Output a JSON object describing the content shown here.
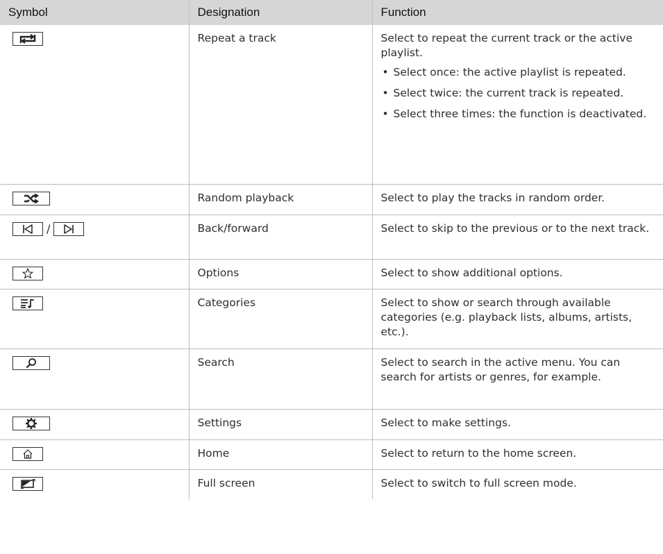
{
  "header": {
    "symbol": "Symbol",
    "designation": "Designation",
    "function": "Function"
  },
  "rows": [
    {
      "icon": "repeat-icon",
      "designation": "Repeat a track",
      "function": "Select to repeat the current track or the active playlist.",
      "bullets": [
        "Select once: the active playlist is repea­ted.",
        "Select twice: the current track is repea­ted.",
        "Select three times: the function is deactivated."
      ]
    },
    {
      "icon": "shuffle-icon",
      "designation": "Random playback",
      "function": "Select to play the tracks in random order."
    },
    {
      "icon": "skip-back-icon / skip-forward-icon",
      "separator": "/",
      "designation": "Back/forward",
      "function": "Select to skip to the previous or to the next track."
    },
    {
      "icon": "star-outline-icon",
      "designation": "Options",
      "function": "Select to show additional options."
    },
    {
      "icon": "playlist-music-icon",
      "designation": "Categories",
      "function": "Select to show or search through available categories (e.g. playback lists, albums, artists, etc.)."
    },
    {
      "icon": "search-icon",
      "designation": "Search",
      "function": "Select to search in the active menu. You can search for artists or genres, for exam­ple."
    },
    {
      "icon": "gear-icon",
      "designation": "Settings",
      "function": "Select to make settings."
    },
    {
      "icon": "home-icon",
      "designation": "Home",
      "function": "Select to return to the home screen."
    },
    {
      "icon": "fullscreen-icon",
      "designation": "Full screen",
      "function": "Select to switch to full screen mode."
    }
  ],
  "bullet_char": "•"
}
